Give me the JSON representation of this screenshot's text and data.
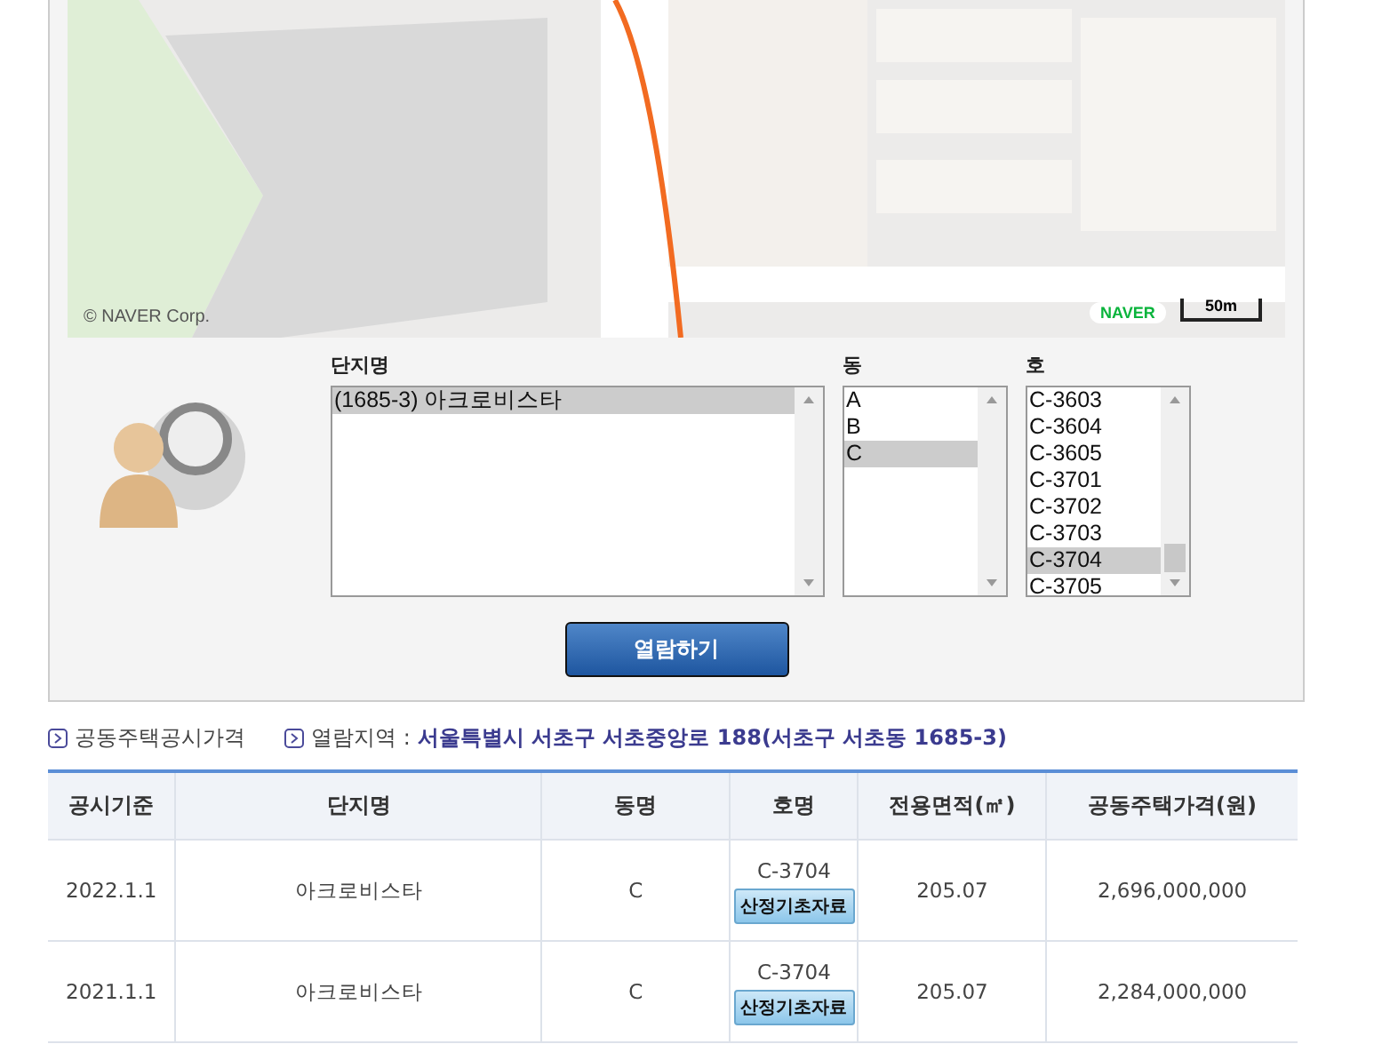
{
  "map": {
    "copyright": "© NAVER Corp.",
    "logo": "NAVER",
    "scale": "50m"
  },
  "selector": {
    "lists": [
      {
        "label": "단지명",
        "options": [
          {
            "text": "(1685-3) 아크로비스타",
            "selected": true
          }
        ]
      },
      {
        "label": "동",
        "options": [
          {
            "text": "A",
            "selected": false
          },
          {
            "text": "B",
            "selected": false
          },
          {
            "text": "C",
            "selected": true
          }
        ]
      },
      {
        "label": "호",
        "options": [
          {
            "text": "C-3603",
            "selected": false
          },
          {
            "text": "C-3604",
            "selected": false
          },
          {
            "text": "C-3605",
            "selected": false
          },
          {
            "text": "C-3701",
            "selected": false
          },
          {
            "text": "C-3702",
            "selected": false
          },
          {
            "text": "C-3703",
            "selected": false
          },
          {
            "text": "C-3704",
            "selected": true
          },
          {
            "text": "C-3705",
            "selected": false
          }
        ]
      }
    ],
    "button": "열람하기"
  },
  "info": {
    "title": "공동주택공시가격",
    "region_label": "열람지역 :",
    "region": "서울특별시 서초구 서초중앙로 188(서초구 서초동 1685-3)"
  },
  "table": {
    "columns": [
      "공시기준",
      "단지명",
      "동명",
      "호명",
      "전용면적(㎡)",
      "공동주택가격(원)"
    ],
    "rows": [
      {
        "date": "2022.1.1",
        "complex": "아크로비스타",
        "dong": "C",
        "ho": "C-3704",
        "ho_button": "산정기초자료",
        "area": "205.07",
        "price": "2,696,000,000"
      },
      {
        "date": "2021.1.1",
        "complex": "아크로비스타",
        "dong": "C",
        "ho": "C-3704",
        "ho_button": "산정기초자료",
        "area": "205.07",
        "price": "2,284,000,000"
      }
    ]
  }
}
